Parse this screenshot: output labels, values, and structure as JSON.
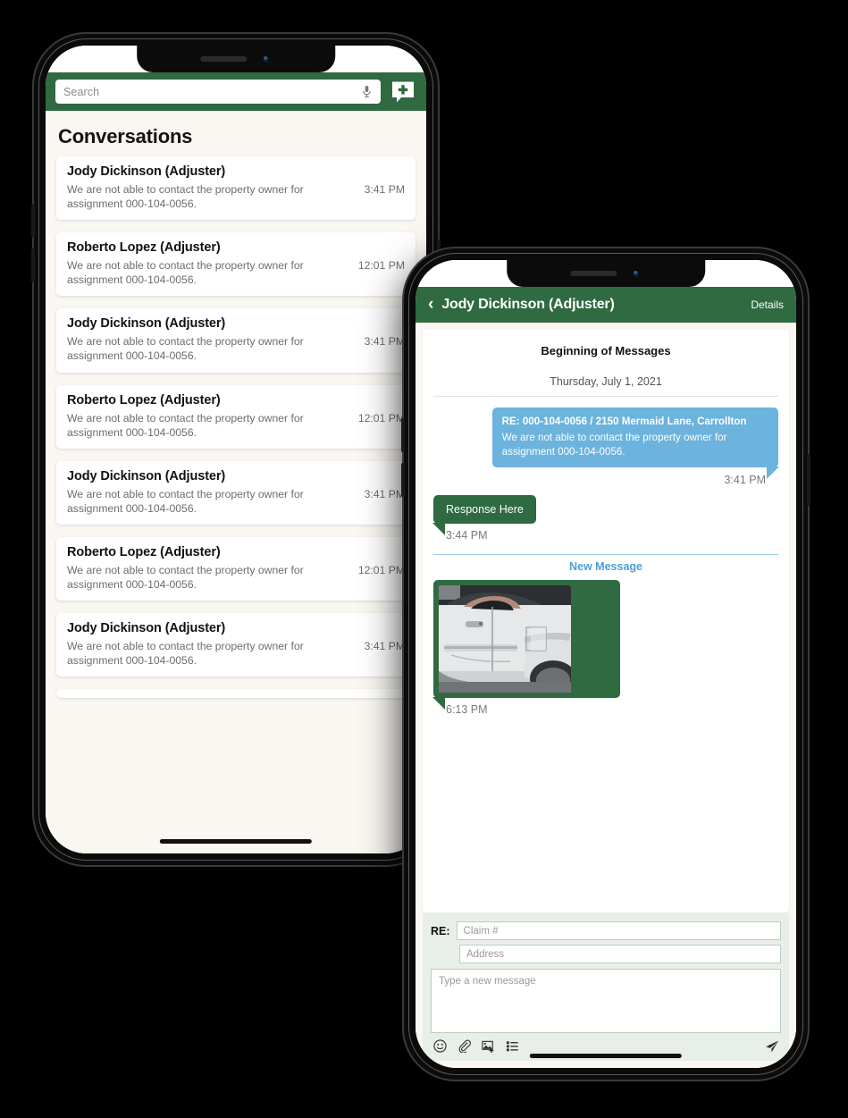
{
  "colors": {
    "brand_green": "#2f6a40",
    "incoming_blue": "#6cb3dd",
    "app_background": "#faf7f2",
    "composer_background": "#e8efe9",
    "new_message_link": "#4ca0d4"
  },
  "phone1": {
    "search": {
      "placeholder": "Search",
      "mic_icon": "microphone-icon"
    },
    "compose_icon": "new-conversation-icon",
    "page_title": "Conversations",
    "conversations": [
      {
        "name": "Jody Dickinson (Adjuster)",
        "preview": "We are not able to contact the property owner for assignment 000-104-0056.",
        "time": "3:41 PM"
      },
      {
        "name": "Roberto Lopez (Adjuster)",
        "preview": "We are not able to contact the property owner for assignment 000-104-0056.",
        "time": "12:01 PM"
      },
      {
        "name": "Jody Dickinson (Adjuster)",
        "preview": "We are not able to contact the property owner for assignment 000-104-0056.",
        "time": "3:41 PM"
      },
      {
        "name": "Roberto Lopez (Adjuster)",
        "preview": "We are not able to contact the property owner for assignment 000-104-0056.",
        "time": "12:01 PM"
      },
      {
        "name": "Jody Dickinson (Adjuster)",
        "preview": "We are not able to contact the property owner for assignment 000-104-0056.",
        "time": "3:41 PM"
      },
      {
        "name": "Roberto Lopez (Adjuster)",
        "preview": "We are not able to contact the property owner for assignment 000-104-0056.",
        "time": "12:01 PM"
      },
      {
        "name": "Jody Dickinson (Adjuster)",
        "preview": "We are not able to contact the property owner for assignment 000-104-0056.",
        "time": "3:41 PM"
      }
    ]
  },
  "phone2": {
    "header": {
      "back_icon": "chevron-left-icon",
      "title": "Jody Dickinson (Adjuster)",
      "details_label": "Details"
    },
    "thread": {
      "beginning_label": "Beginning of Messages",
      "date_label": "Thursday, July 1, 2021",
      "messages": [
        {
          "direction": "incoming",
          "subject": "RE: 000-104-0056 /  2150 Mermaid Lane, Carrollton",
          "text": "We are not able to contact the property owner for assignment 000-104-0056.",
          "time": "3:41 PM"
        },
        {
          "direction": "outgoing",
          "text": "Response Here",
          "time": "3:44 PM"
        },
        {
          "direction": "outgoing",
          "type": "image",
          "alt": "damaged-white-pickup-truck-side-panel-photo",
          "time": "6:13 PM"
        }
      ],
      "new_message_divider": "New Message"
    },
    "composer": {
      "re_label": "RE:",
      "claim_placeholder": "Claim #",
      "address_placeholder": "Address",
      "message_placeholder": "Type a new message",
      "tools": [
        {
          "icon": "emoji-icon"
        },
        {
          "icon": "paperclip-icon"
        },
        {
          "icon": "add-image-icon"
        },
        {
          "icon": "template-list-icon"
        }
      ],
      "send_icon": "send-paper-plane-icon"
    }
  }
}
